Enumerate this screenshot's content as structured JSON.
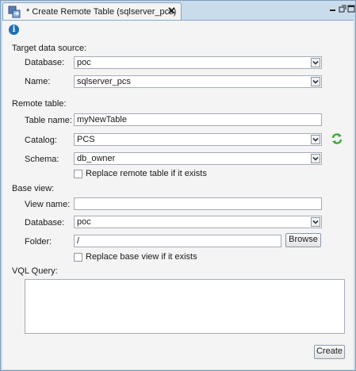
{
  "tab": {
    "title": "* Create Remote Table (sqlserver_pcs)",
    "close": "✕"
  },
  "target": {
    "section": "Target data source:",
    "database_label": "Database:",
    "database_value": "poc",
    "name_label": "Name:",
    "name_value": "sqlserver_pcs"
  },
  "remote": {
    "section": "Remote table:",
    "table_label": "Table name:",
    "table_value": "myNewTable",
    "catalog_label": "Catalog:",
    "catalog_value": "PCS",
    "schema_label": "Schema:",
    "schema_value": "db_owner",
    "replace_label": "Replace remote table if it exists"
  },
  "base": {
    "section": "Base view:",
    "view_label": "View name:",
    "view_value": "",
    "database_label": "Database:",
    "database_value": "poc",
    "folder_label": "Folder:",
    "folder_value": "/",
    "browse_label": "Browse",
    "replace_label": "Replace base view if it exists"
  },
  "vql": {
    "label": "VQL Query:",
    "value": ""
  },
  "create_label": "Create",
  "colors": {
    "accent": "#1f6fb5",
    "refresh": "#3ea83a",
    "frame": "#c9dcec"
  }
}
